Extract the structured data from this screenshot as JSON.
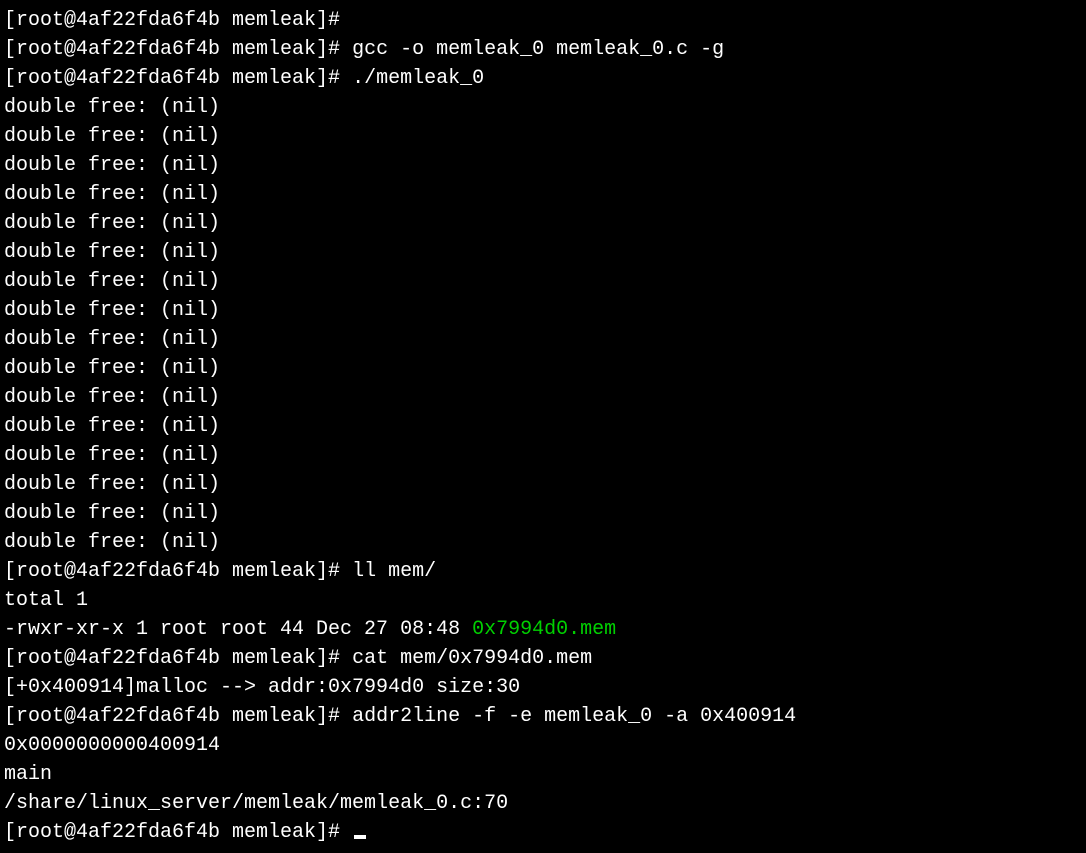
{
  "prompt": {
    "user": "root",
    "host": "4af22fda6f4b",
    "cwd": "memleak",
    "symbol": "#"
  },
  "commands": {
    "empty": "",
    "compile": "gcc -o memleak_0 memleak_0.c -g",
    "run": "./memleak_0",
    "ll": "ll mem/",
    "cat": "cat mem/0x7994d0.mem",
    "addr2line": "addr2line -f -e memleak_0 -a 0x400914"
  },
  "output": {
    "double_free_line": "double free: (nil)",
    "double_free_count": 16,
    "ll_total": "total 1",
    "ll_entry": {
      "perms": "-rwxr-xr-x",
      "links": "1",
      "owner": "root",
      "group": "root",
      "size": "44",
      "date": "Dec 27 08:48",
      "filename": "0x7994d0.mem"
    },
    "cat_content": "[+0x400914]malloc --> addr:0x7994d0 size:30",
    "addr2line_result": {
      "addr": "0x0000000000400914",
      "func": "main",
      "loc": "/share/linux_server/memleak/memleak_0.c:70"
    }
  }
}
